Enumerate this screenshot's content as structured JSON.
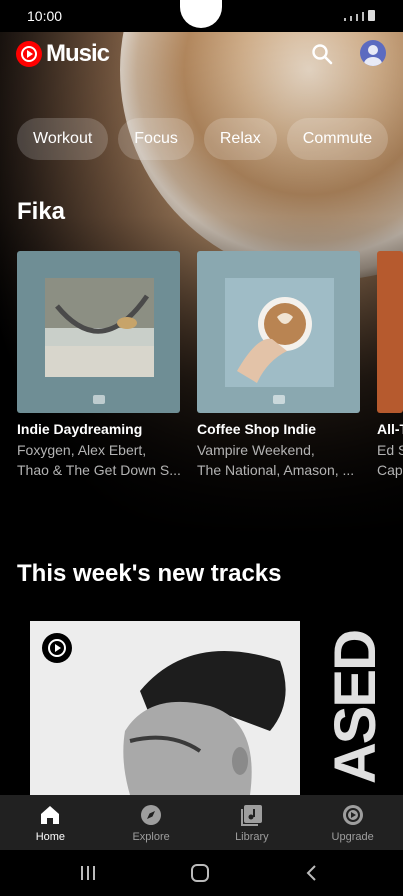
{
  "status_bar": {
    "time": "10:00"
  },
  "header": {
    "logo_text": "Music",
    "search_icon": "search-icon",
    "avatar_icon": "account-icon"
  },
  "chips": [
    "Workout",
    "Focus",
    "Relax",
    "Commute"
  ],
  "fika": {
    "title": "Fika",
    "cards": [
      {
        "title": "Indie Daydreaming",
        "subtitle_line1": "Foxygen, Alex Ebert,",
        "subtitle_line2": "Thao & The Get Down S..."
      },
      {
        "title": "Coffee Shop Indie",
        "subtitle_line1": "Vampire Weekend,",
        "subtitle_line2": "The National, Amason, ..."
      },
      {
        "title": "All-T",
        "subtitle_line1": "Ed S",
        "subtitle_line2": "Cap"
      }
    ]
  },
  "new_tracks": {
    "title": "This week's new tracks",
    "side_text": "ASED"
  },
  "bottom_nav": [
    {
      "label": "Home",
      "icon": "home-icon",
      "active": true
    },
    {
      "label": "Explore",
      "icon": "compass-icon",
      "active": false
    },
    {
      "label": "Library",
      "icon": "library-icon",
      "active": false
    },
    {
      "label": "Upgrade",
      "icon": "upgrade-icon",
      "active": false
    }
  ],
  "colors": {
    "accent": "#ff0000",
    "nav_bg": "#212121",
    "muted_text": "#b3b3b3"
  }
}
